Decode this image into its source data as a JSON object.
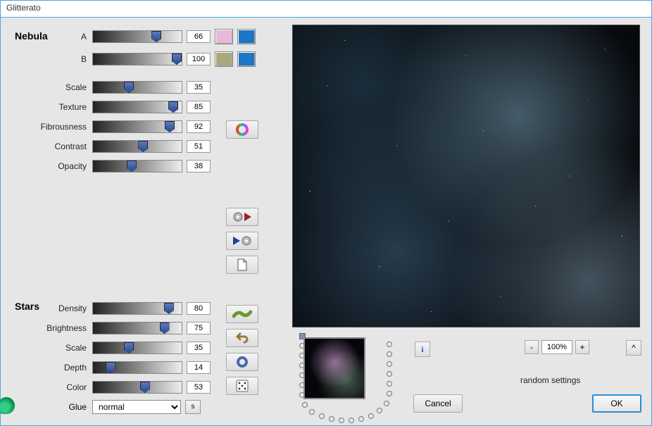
{
  "title": "Glitterato",
  "nebula": {
    "header": "Nebula",
    "a": {
      "label": "A",
      "value": "66",
      "pos": 66,
      "swatch1": "#e7b8da",
      "swatch2": "#1d76c6"
    },
    "b": {
      "label": "B",
      "value": "100",
      "pos": 100,
      "swatch1": "#a8a87c",
      "swatch2": "#1d76c6"
    },
    "scale": {
      "label": "Scale",
      "value": "35",
      "pos": 35
    },
    "texture": {
      "label": "Texture",
      "value": "85",
      "pos": 85
    },
    "fibrousness": {
      "label": "Fibrousness",
      "value": "92",
      "pos": 92
    },
    "contrast": {
      "label": "Contrast",
      "value": "51",
      "pos": 51
    },
    "opacity": {
      "label": "Opacity",
      "value": "38",
      "pos": 38
    }
  },
  "stars": {
    "header": "Stars",
    "density": {
      "label": "Density",
      "value": "80",
      "pos": 80
    },
    "brightness": {
      "label": "Brightness",
      "value": "75",
      "pos": 75
    },
    "scale": {
      "label": "Scale",
      "value": "35",
      "pos": 35
    },
    "depth": {
      "label": "Depth",
      "value": "14",
      "pos": 14
    },
    "color": {
      "label": "Color",
      "value": "53",
      "pos": 53
    }
  },
  "glue": {
    "label": "Glue",
    "value": "normal",
    "s": "s"
  },
  "zoom": {
    "minus": "-",
    "value": "100%",
    "plus": "+"
  },
  "caret": "^",
  "random_label": "random settings",
  "info": "i",
  "cancel": "Cancel",
  "ok": "OK"
}
